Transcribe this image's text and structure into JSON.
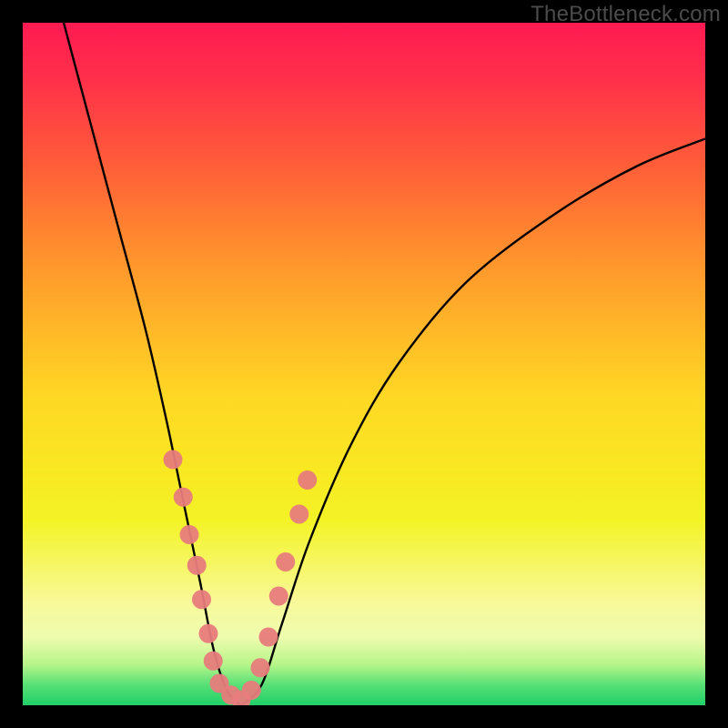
{
  "watermark": "TheBottleneck.com",
  "chart_data": {
    "type": "line",
    "title": "",
    "xlabel": "",
    "ylabel": "",
    "xlim": [
      0,
      100
    ],
    "ylim": [
      0,
      100
    ],
    "grid": false,
    "curve_left": [
      {
        "x": 6,
        "y": 100
      },
      {
        "x": 10,
        "y": 85
      },
      {
        "x": 14,
        "y": 70
      },
      {
        "x": 18,
        "y": 55
      },
      {
        "x": 21,
        "y": 42
      },
      {
        "x": 23.5,
        "y": 30
      },
      {
        "x": 26,
        "y": 18
      },
      {
        "x": 28,
        "y": 8
      },
      {
        "x": 30,
        "y": 2
      },
      {
        "x": 32,
        "y": 0
      }
    ],
    "curve_right": [
      {
        "x": 32,
        "y": 0
      },
      {
        "x": 35,
        "y": 3
      },
      {
        "x": 38,
        "y": 12
      },
      {
        "x": 42,
        "y": 24
      },
      {
        "x": 48,
        "y": 38
      },
      {
        "x": 55,
        "y": 50
      },
      {
        "x": 65,
        "y": 62
      },
      {
        "x": 78,
        "y": 72
      },
      {
        "x": 90,
        "y": 79
      },
      {
        "x": 100,
        "y": 83
      }
    ],
    "markers": [
      {
        "x": 22.0,
        "y": 36.0
      },
      {
        "x": 23.5,
        "y": 30.5
      },
      {
        "x": 24.4,
        "y": 25.0
      },
      {
        "x": 25.5,
        "y": 20.5
      },
      {
        "x": 26.2,
        "y": 15.5
      },
      {
        "x": 27.2,
        "y": 10.5
      },
      {
        "x": 27.9,
        "y": 6.5
      },
      {
        "x": 28.8,
        "y": 3.2
      },
      {
        "x": 30.5,
        "y": 1.5
      },
      {
        "x": 32.0,
        "y": 0.8
      },
      {
        "x": 33.5,
        "y": 2.2
      },
      {
        "x": 34.8,
        "y": 5.5
      },
      {
        "x": 36.0,
        "y": 10.0
      },
      {
        "x": 37.5,
        "y": 16.0
      },
      {
        "x": 38.5,
        "y": 21.0
      },
      {
        "x": 40.5,
        "y": 28.0
      },
      {
        "x": 41.7,
        "y": 33.0
      }
    ],
    "marker_color": "#e77c7c",
    "curve_color": "#000000"
  }
}
